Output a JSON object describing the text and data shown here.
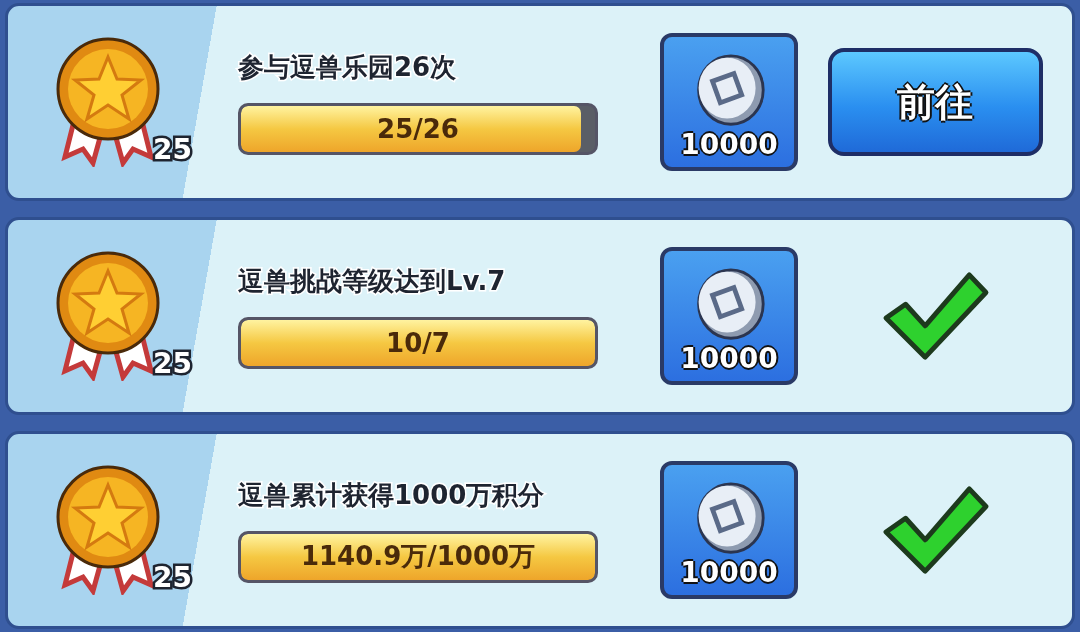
{
  "tasks": [
    {
      "medal_count": "25",
      "title": "参与逗兽乐园26次",
      "progress": {
        "level": 0.96,
        "text": "25/26"
      },
      "reward": "10000",
      "action": {
        "kind": "button",
        "label": "前往"
      }
    },
    {
      "medal_count": "25",
      "title": "逗兽挑战等级达到Lv.7",
      "progress": {
        "level": 1,
        "text": "10/7"
      },
      "reward": "10000",
      "action": {
        "kind": "check"
      }
    },
    {
      "medal_count": "25",
      "title": "逗兽累计获得1000万积分",
      "progress": {
        "level": 1,
        "text": "1140.9万/1000万"
      },
      "reward": "10000",
      "action": {
        "kind": "check"
      }
    }
  ]
}
